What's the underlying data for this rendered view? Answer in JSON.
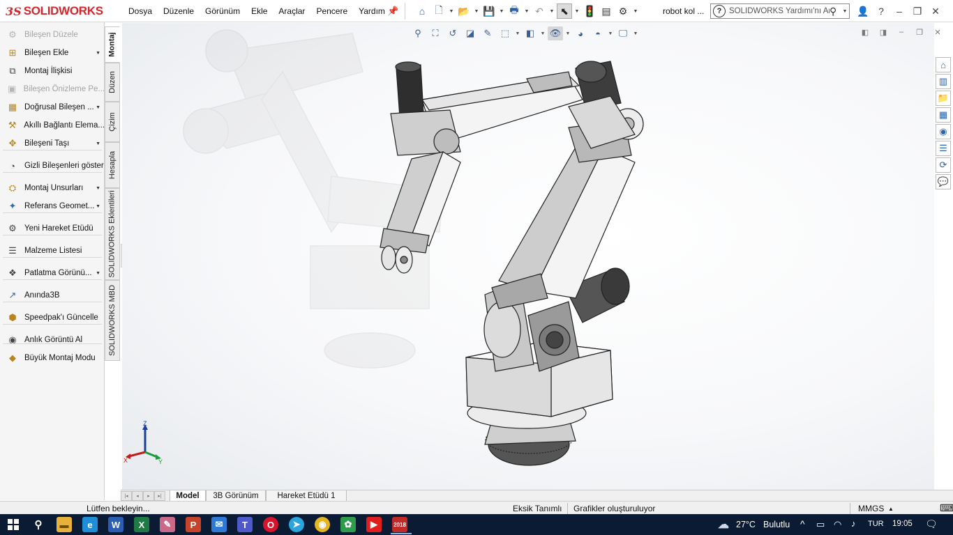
{
  "app": {
    "logo_prefix": "3S",
    "logo_text": "SOLIDWORKS",
    "menus": [
      "Dosya",
      "Düzenle",
      "Görünüm",
      "Ekle",
      "Araçlar",
      "Pencere",
      "Yardım"
    ],
    "document_name": "robot kol ...",
    "search_placeholder": "SOLIDWORKS Yardımı'nı Ara",
    "search_badge": "?"
  },
  "command_manager": {
    "items": [
      {
        "label": "Bileşen Düzele",
        "icon": "edit-component-icon",
        "disabled": true,
        "caret": false
      },
      {
        "label": "Bileşen Ekle",
        "icon": "insert-component-icon",
        "disabled": false,
        "caret": true
      },
      {
        "label": "Montaj İlişkisi",
        "icon": "mate-paperclip-icon",
        "disabled": false,
        "caret": false
      },
      {
        "label": "Bileşen Önizleme Pe...",
        "icon": "component-preview-icon",
        "disabled": true,
        "caret": false
      },
      {
        "label": "Doğrusal Bileşen ...",
        "icon": "linear-pattern-icon",
        "disabled": false,
        "caret": true
      },
      {
        "label": "Akıllı Bağlantı Elema...",
        "icon": "smart-fasteners-icon",
        "disabled": false,
        "caret": false
      },
      {
        "label": "Bileşeni Taşı",
        "icon": "move-component-icon",
        "disabled": false,
        "caret": true
      },
      {
        "label": "Gizli Bileşenleri göster",
        "icon": "show-hidden-icon",
        "disabled": false,
        "caret": false
      },
      {
        "label": "Montaj Unsurları",
        "icon": "assembly-features-icon",
        "disabled": false,
        "caret": true
      },
      {
        "label": "Referans Geomet...",
        "icon": "reference-geometry-icon",
        "disabled": false,
        "caret": true
      },
      {
        "label": "Yeni Hareket Etüdü",
        "icon": "motion-study-icon",
        "disabled": false,
        "caret": false
      },
      {
        "label": "Malzeme Listesi",
        "icon": "bill-of-materials-icon",
        "disabled": false,
        "caret": false
      },
      {
        "label": "Patlatma Görünü...",
        "icon": "exploded-view-icon",
        "disabled": false,
        "caret": true
      },
      {
        "label": "Anında3B",
        "icon": "instant3d-icon",
        "disabled": false,
        "caret": false
      },
      {
        "label": "Speedpak'ı Güncelle",
        "icon": "speedpak-icon",
        "disabled": false,
        "caret": false
      },
      {
        "label": "Anlık Görüntü Al",
        "icon": "camera-icon",
        "disabled": false,
        "caret": false
      },
      {
        "label": "Büyük Montaj Modu",
        "icon": "large-assembly-icon",
        "disabled": false,
        "caret": false
      }
    ]
  },
  "vertical_tabs": [
    "Montaj",
    "Düzen",
    "Çizim",
    "Hesapla",
    "SOLIDWORKS Eklentileri",
    "SOLIDWORKS MBD"
  ],
  "bottom_tabs": [
    "Model",
    "3B Görünüm",
    "Hareket Etüdü 1"
  ],
  "triad": {
    "z": "Z",
    "x": "X",
    "y": "Y"
  },
  "status": {
    "message": "Lütfen bekleyin...",
    "definition": "Eksik Tanımlı",
    "graphics": "Grafikler oluşturuluyor",
    "units": "MMGS"
  },
  "taskbar": {
    "weather": "27°C",
    "weather_desc": "Bulutlu",
    "language": "TUR",
    "time": "19:05",
    "sw_badge": "2018"
  },
  "colors": {
    "brand_red": "#d4262b",
    "taskbar": "#0b1b33",
    "accent_blue": "#2b5c9e"
  }
}
